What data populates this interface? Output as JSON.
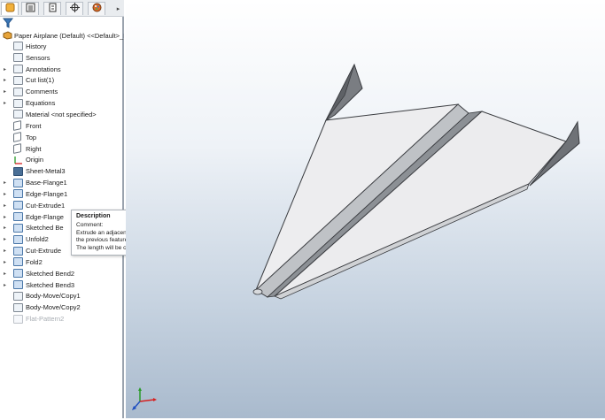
{
  "tabs": [
    {
      "icon": "feature-manager-icon"
    },
    {
      "icon": "property-manager-icon"
    },
    {
      "icon": "configuration-manager-icon"
    },
    {
      "icon": "dimxpert-icon"
    },
    {
      "icon": "display-manager-icon"
    }
  ],
  "tab_more_glyph": "▸",
  "filter_icon": "filter-icon",
  "root_label": "Paper Airplane (Default) <<Default>_Pho",
  "tree": [
    {
      "label": "History",
      "expand": "",
      "icon": "history-icon"
    },
    {
      "label": "Sensors",
      "expand": "",
      "icon": "sensors-icon"
    },
    {
      "label": "Annotations",
      "expand": "▸",
      "icon": "annotations-icon"
    },
    {
      "label": "Cut list(1)",
      "expand": "▸",
      "icon": "cut-list-icon"
    },
    {
      "label": "Comments",
      "expand": "▸",
      "icon": "comments-icon"
    },
    {
      "label": "Equations",
      "expand": "▸",
      "icon": "equations-icon"
    },
    {
      "label": "Material <not specified>",
      "expand": "",
      "icon": "material-icon"
    },
    {
      "label": "Front",
      "expand": "",
      "icon": "plane-icon"
    },
    {
      "label": "Top",
      "expand": "",
      "icon": "plane-icon"
    },
    {
      "label": "Right",
      "expand": "",
      "icon": "plane-icon"
    },
    {
      "label": "Origin",
      "expand": "",
      "icon": "origin-icon"
    },
    {
      "label": "Sheet-Metal3",
      "expand": "",
      "icon": "sheet-metal-icon"
    },
    {
      "label": "Base-Flange1",
      "expand": "▸",
      "icon": "base-flange-icon"
    },
    {
      "label": "Edge-Flange1",
      "expand": "▸",
      "icon": "edge-flange-icon"
    },
    {
      "label": "Cut-Extrude1",
      "expand": "▸",
      "icon": "cut-extrude-icon"
    },
    {
      "label": "Edge-Flange",
      "expand": "▸",
      "icon": "edge-flange-icon"
    },
    {
      "label": "Sketched Be",
      "expand": "▸",
      "icon": "sketched-bend-icon"
    },
    {
      "label": "Unfold2",
      "expand": "▸",
      "icon": "unfold-icon"
    },
    {
      "label": "Cut-Extrude",
      "expand": "▸",
      "icon": "cut-extrude-icon"
    },
    {
      "label": "Fold2",
      "expand": "▸",
      "icon": "fold-icon"
    },
    {
      "label": "Sketched Bend2",
      "expand": "▸",
      "icon": "sketched-bend-icon"
    },
    {
      "label": "Sketched Bend3",
      "expand": "▸",
      "icon": "sketched-bend-icon"
    },
    {
      "label": "Body-Move/Copy1",
      "expand": "",
      "icon": "body-move-icon"
    },
    {
      "label": "Body-Move/Copy2",
      "expand": "",
      "icon": "body-move-icon"
    },
    {
      "label": "Flat-Pattern2",
      "expand": "",
      "icon": "flat-pattern-icon",
      "suppressed": true
    }
  ],
  "tooltip": {
    "title": "Description",
    "line1": "Comment:",
    "line2": "Extrude an adjacent edge flange with a mirror angle to",
    "line3": "the previous feature and a longer length than necessary.",
    "line4": "The length will be cut later on in the process."
  },
  "colors": {
    "model_light": "#ecedef",
    "model_mid": "#d4d6d9",
    "model_dark": "#6d7075",
    "model_edge": "#3a3c40",
    "triad_x": "#d62020",
    "triad_y": "#2a9a2a",
    "triad_z": "#2050c0"
  }
}
